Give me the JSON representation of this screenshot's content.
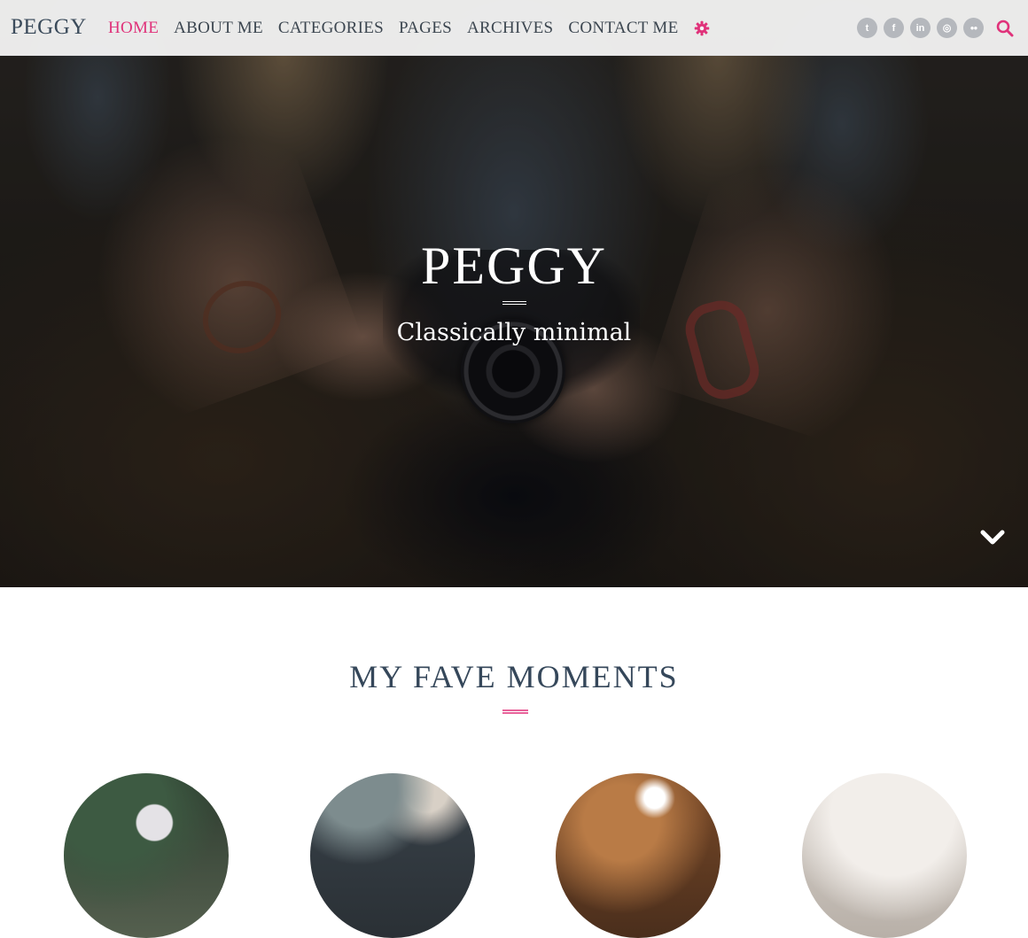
{
  "site": {
    "logo": "PEGGY"
  },
  "nav": {
    "items": [
      {
        "label": "HOME",
        "active": true
      },
      {
        "label": "ABOUT ME",
        "active": false
      },
      {
        "label": "CATEGORIES",
        "active": false
      },
      {
        "label": "PAGES",
        "active": false
      },
      {
        "label": "ARCHIVES",
        "active": false
      },
      {
        "label": "CONTACT ME",
        "active": false
      }
    ],
    "settings_icon": "gear-icon",
    "accent_color": "#e0327a"
  },
  "social": {
    "icons": [
      {
        "name": "twitter-icon",
        "glyph": "t"
      },
      {
        "name": "facebook-icon",
        "glyph": "f"
      },
      {
        "name": "linkedin-icon",
        "glyph": "in"
      },
      {
        "name": "instagram-icon",
        "glyph": "◎"
      },
      {
        "name": "flickr-icon",
        "glyph": "●●"
      }
    ],
    "search_icon": "search-icon"
  },
  "hero": {
    "title": "PEGGY",
    "subtitle": "Classically minimal",
    "scroll_icon": "chevron-down-icon"
  },
  "section": {
    "title": "MY FAVE MOMENTS",
    "rule_color": "#e8629a",
    "moments_count": 4
  }
}
